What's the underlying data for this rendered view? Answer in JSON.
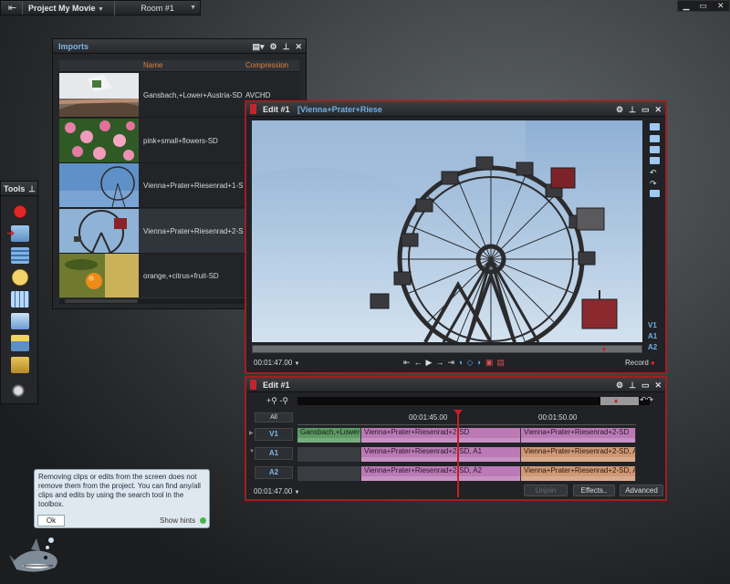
{
  "topbar": {
    "project_title": "Project My Movie",
    "room": "Room #1",
    "exit_icon": "exit-icon",
    "window_controls": [
      "minimize-icon",
      "maximize-icon",
      "close-icon"
    ]
  },
  "imports": {
    "title": "Imports",
    "columns": {
      "name": "Name",
      "compression": "Compression"
    },
    "rows": [
      {
        "name": "Gansbach,+Lower+Austria-SD",
        "compression": "AVCHD",
        "thumb": "church-tower"
      },
      {
        "name": "pink+small+flowers-SD",
        "compression": "",
        "thumb": "pink-flowers"
      },
      {
        "name": "Vienna+Prater+Riesenrad+1-S",
        "compression": "",
        "thumb": "ferris-wheel"
      },
      {
        "name": "Vienna+Prater+Riesenrad+2-S",
        "compression": "",
        "thumb": "ferris-wheel-gondola",
        "selected": true
      },
      {
        "name": "orange,+citrus+fruit-SD",
        "compression": "",
        "thumb": "orange-fruit"
      }
    ]
  },
  "tools": {
    "title": "Tools",
    "icons": [
      "record-icon",
      "import-icon",
      "timeline-icon",
      "cd-icon",
      "grid-icon",
      "layers-icon",
      "effects-icon",
      "export-icon",
      "users-icon"
    ]
  },
  "edit": {
    "title": "Edit #1",
    "clip_name": "[Vienna+Prater+Riese",
    "timecode": "00:01:47.00",
    "record_label": "Record",
    "tracks": [
      "V1",
      "A1",
      "A2"
    ]
  },
  "timeline": {
    "title": "Edit #1",
    "all_label": "All",
    "time_marks": [
      "00:01:45.00",
      "00:01:50.00"
    ],
    "timecode": "00:01:47.00",
    "buttons": {
      "unjoin": "Unjoin",
      "effects": "Effects..",
      "advanced": "Advanced"
    },
    "tracks": [
      {
        "label": "V1",
        "clips": [
          "Gansbach,+Lower+",
          "Vienna+Prater+Riesenrad+2-SD",
          "Vienna+Prater+Riesenrad+2-SD"
        ]
      },
      {
        "label": "A1",
        "clips": [
          "",
          "Vienna+Prater+Riesenrad+2-SD, A1",
          "Vienna+Prater+Riesenrad+2-SD, A"
        ]
      },
      {
        "label": "A2",
        "clips": [
          "",
          "Vienna+Prater+Riesenrad+2-SD, A2",
          "Vienna+Prater+Riesenrad+2-SD, A"
        ]
      }
    ]
  },
  "hint": {
    "text": "Removing clips or edits from the screen does not remove them from the project.  You can find any/all clips and edits by using the search tool in the toolbox.",
    "ok_label": "Ok",
    "show_hints_label": "Show hints"
  },
  "colors": {
    "accent_blue": "#6fb0e6",
    "header_orange": "#e0823b",
    "active_border_red": "#a01e22",
    "clip_video": "#bb7ab6",
    "clip_audio": "#d09875",
    "clip_green": "#5b9a62"
  }
}
